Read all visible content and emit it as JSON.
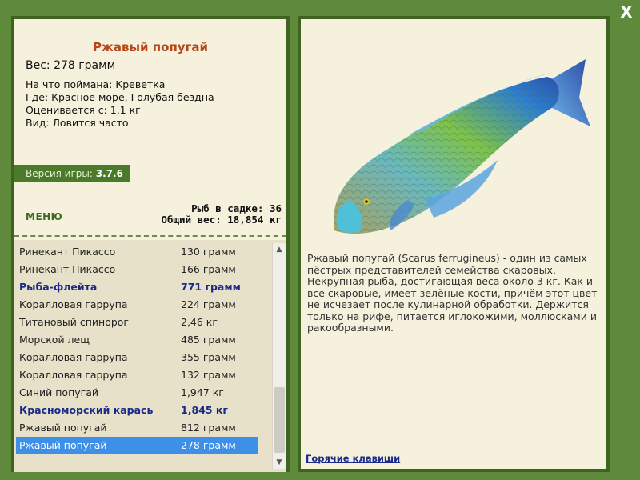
{
  "close_label": "X",
  "fish": {
    "title": "Ржавый попугай",
    "weight_line": "Вес: 278 грамм",
    "caught_with": "На что поймана: Креветка",
    "where": "Где: Красное море, Голубая бездна",
    "value_from": "Оценивается с: 1,1 кг",
    "frequency": "Вид: Ловится часто",
    "description": "Ржавый попугай (Scarus ferrugineus) - один из самых пёстрых представителей семейства скаровых. Некрупная рыба, достигающая веса около 3 кг. Как и все скаровые, имеет зелёные кости, причём этот цвет не исчезает после кулинарной обработки. Держится только на рифе, питается иглокожими, моллюсками и ракообразными."
  },
  "version": {
    "label": "Версия игры:",
    "value": "3.7.6"
  },
  "menu_label": "МЕНЮ",
  "stats": {
    "fish_in_cage": "Рыб в садке: 36",
    "total_weight": "Общий вес: 18,854 кг"
  },
  "catch_list": [
    {
      "name": "Ринекант Пикассо",
      "weight": "130 грамм",
      "highlight": false,
      "selected": false
    },
    {
      "name": "Ринекант Пикассо",
      "weight": "166 грамм",
      "highlight": false,
      "selected": false
    },
    {
      "name": "Рыба-флейта",
      "weight": "771 грамм",
      "highlight": true,
      "selected": false
    },
    {
      "name": "Коралловая гаррупа",
      "weight": "224 грамм",
      "highlight": false,
      "selected": false
    },
    {
      "name": "Титановый спинорог",
      "weight": "2,46 кг",
      "highlight": false,
      "selected": false
    },
    {
      "name": "Морской лещ",
      "weight": "485 грамм",
      "highlight": false,
      "selected": false
    },
    {
      "name": "Коралловая гаррупа",
      "weight": "355 грамм",
      "highlight": false,
      "selected": false
    },
    {
      "name": "Коралловая гаррупа",
      "weight": "132 грамм",
      "highlight": false,
      "selected": false
    },
    {
      "name": "Синий попугай",
      "weight": "1,947 кг",
      "highlight": false,
      "selected": false
    },
    {
      "name": "Красноморский карась",
      "weight": "1,845 кг",
      "highlight": true,
      "selected": false
    },
    {
      "name": "Ржавый попугай",
      "weight": "812 грамм",
      "highlight": false,
      "selected": false
    },
    {
      "name": "Ржавый попугай",
      "weight": "278 грамм",
      "highlight": false,
      "selected": true
    }
  ],
  "hotkeys_label": "Горячие клавиши",
  "colors": {
    "background": "#5f8a3c",
    "panel": "#f5f1dc",
    "title": "#b5471a",
    "highlight": "#1a2a8a",
    "selection": "#3d8fe8"
  },
  "icons": {
    "close": "close-icon",
    "scroll_up": "chevron-up-icon",
    "scroll_down": "chevron-down-icon"
  }
}
